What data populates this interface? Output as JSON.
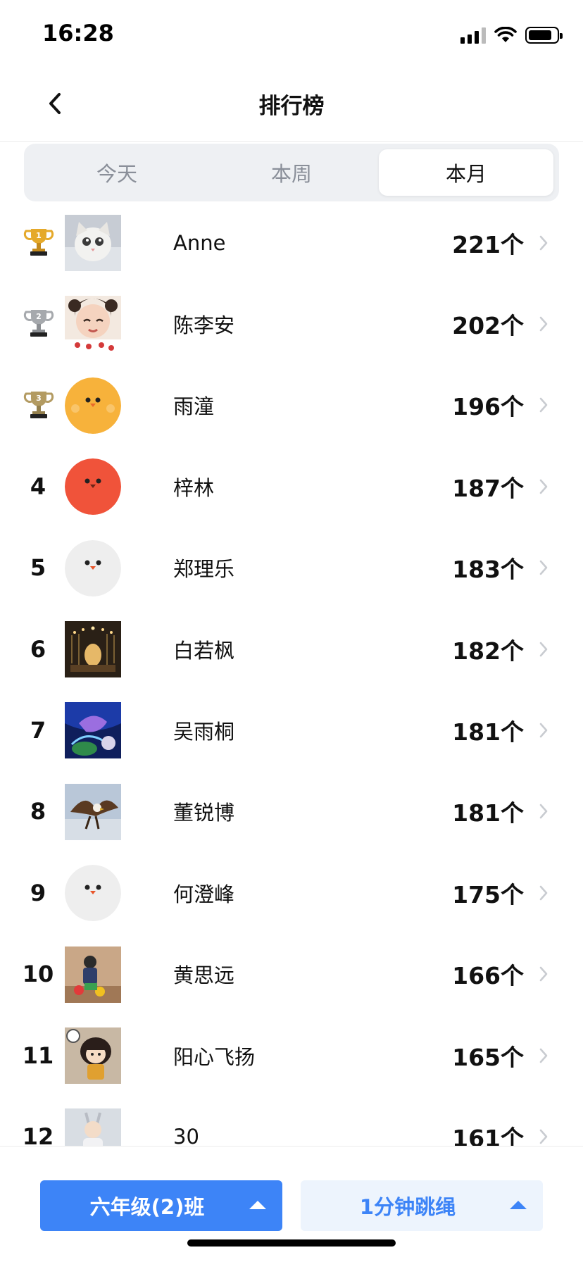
{
  "status_bar": {
    "time": "16:28"
  },
  "nav": {
    "title": "排行榜"
  },
  "segments": [
    {
      "label": "今天",
      "active": false
    },
    {
      "label": "本周",
      "active": false
    },
    {
      "label": "本月",
      "active": true
    }
  ],
  "rows": [
    {
      "rank": "1",
      "trophy": "gold",
      "name": "Anne",
      "count": "221个",
      "avatar": "cat-photo"
    },
    {
      "rank": "2",
      "trophy": "silver",
      "name": "陈李安",
      "count": "202个",
      "avatar": "child-photo"
    },
    {
      "rank": "3",
      "trophy": "bronze",
      "name": "雨潼",
      "count": "196个",
      "avatar": "yellow-chick"
    },
    {
      "rank": "4",
      "name": "梓林",
      "count": "187个",
      "avatar": "red-bird"
    },
    {
      "rank": "5",
      "name": "郑理乐",
      "count": "183个",
      "avatar": "white-bird"
    },
    {
      "rank": "6",
      "name": "白若枫",
      "count": "182个",
      "avatar": "lights-photo"
    },
    {
      "rank": "7",
      "name": "吴雨桐",
      "count": "181个",
      "avatar": "fantasy-art"
    },
    {
      "rank": "8",
      "name": "董锐博",
      "count": "181个",
      "avatar": "eagle-photo"
    },
    {
      "rank": "9",
      "name": "何澄峰",
      "count": "175个",
      "avatar": "white-bird"
    },
    {
      "rank": "10",
      "name": "黄思远",
      "count": "166个",
      "avatar": "toy-photo"
    },
    {
      "rank": "11",
      "name": "阳心飞扬",
      "count": "165个",
      "avatar": "cartoon-girl"
    },
    {
      "rank": "12",
      "name": "30",
      "count": "161个",
      "avatar": "girl-photo"
    }
  ],
  "bottom": {
    "class_label": "六年级(2)班",
    "sport_label": "1分钟跳绳"
  },
  "colors": {
    "accent": "#3d84f7",
    "gold": "#e5a92a",
    "silver": "#a6a9ad",
    "bronze": "#b39b62"
  }
}
